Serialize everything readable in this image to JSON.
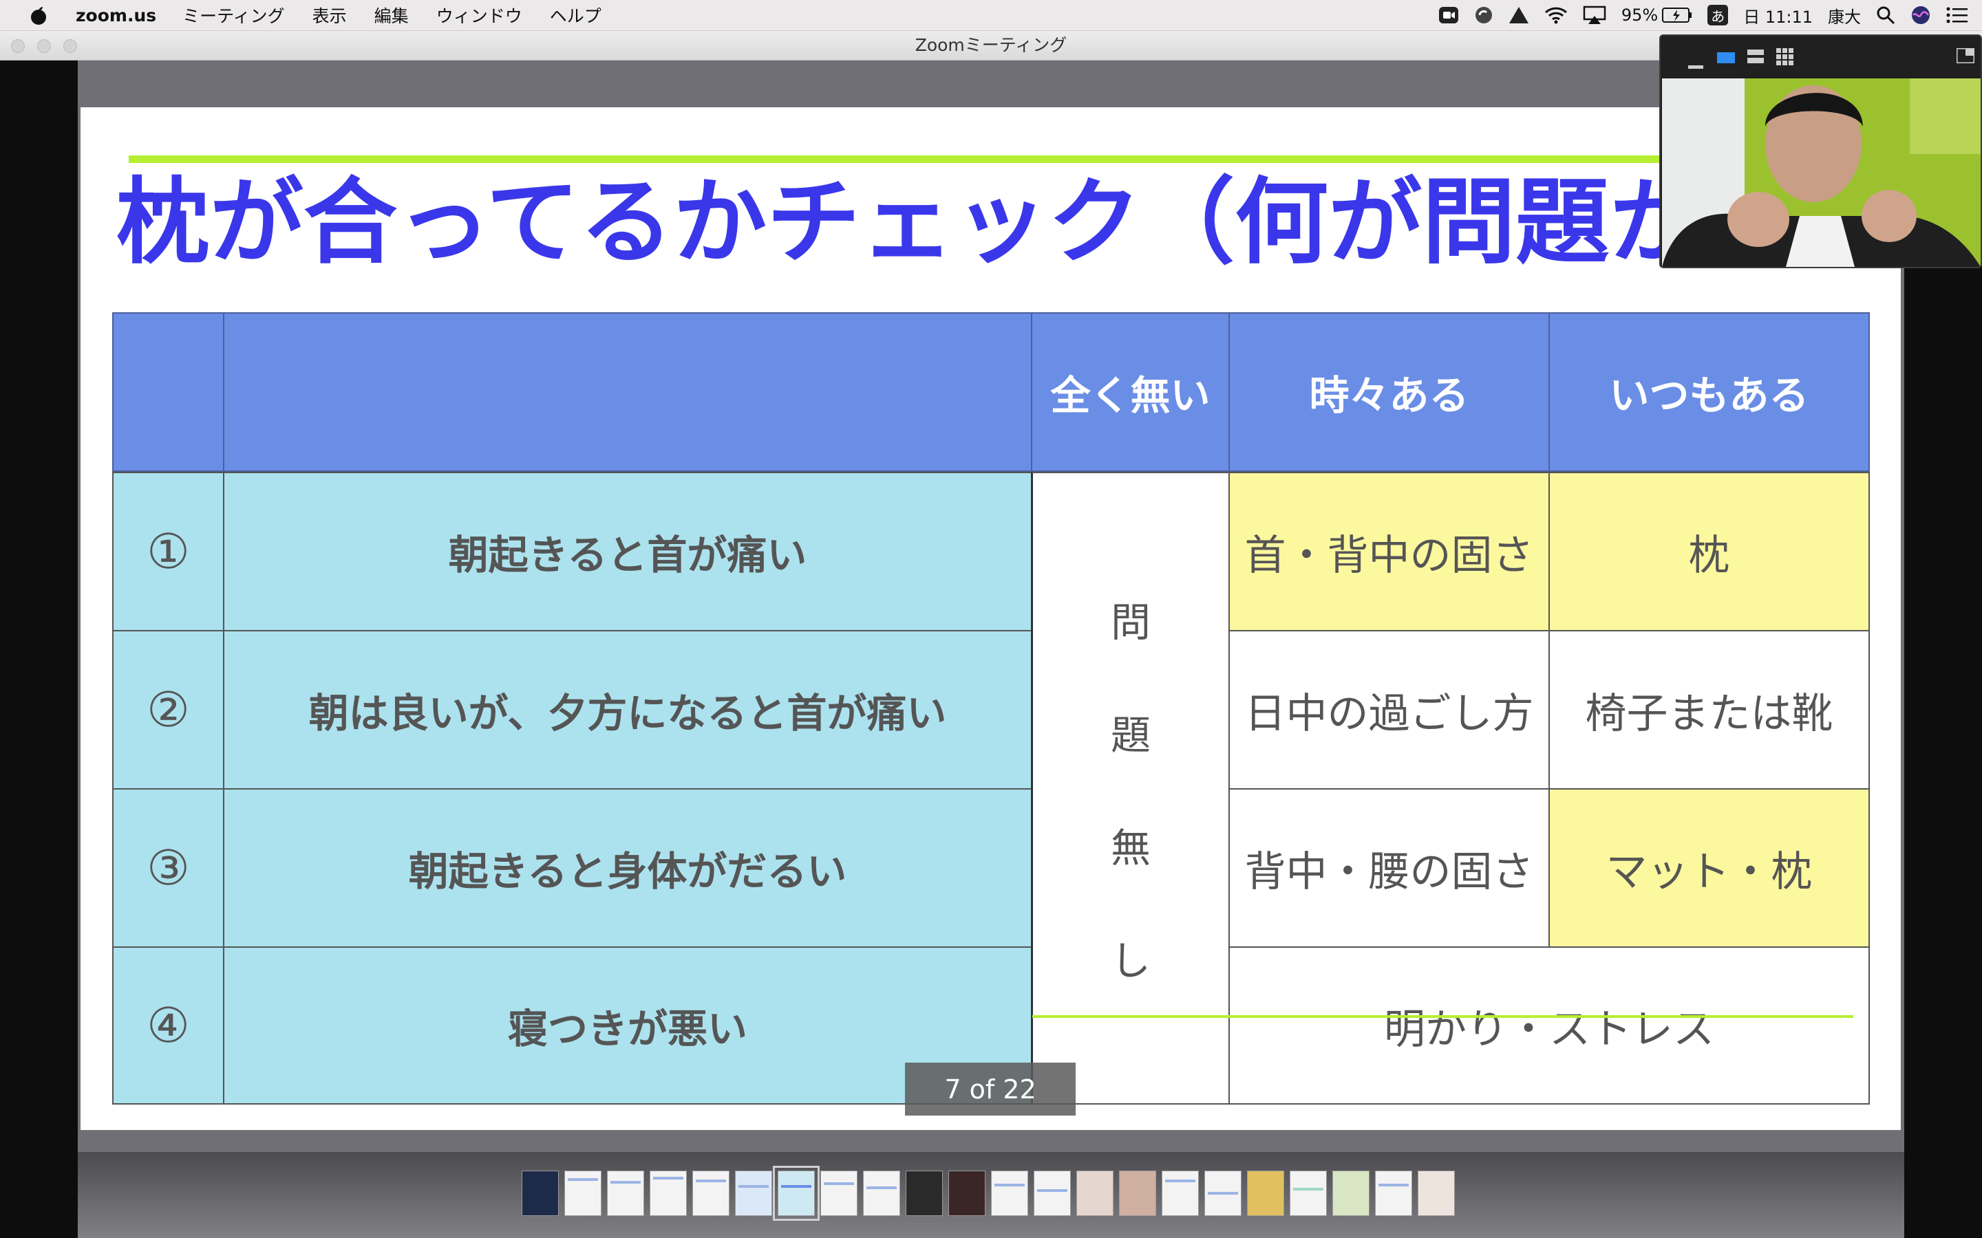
{
  "menubar": {
    "app": "zoom.us",
    "items": [
      "ミーティング",
      "表示",
      "編集",
      "ウィンドウ",
      "ヘルプ"
    ],
    "battery": "95%",
    "ime": "あ",
    "clock": "日 11:11",
    "user": "康大"
  },
  "window": {
    "title": "Zoomミーティング"
  },
  "slide": {
    "title": "枕が合ってるかチェック（何が問題か）",
    "headers": [
      "",
      "",
      "全く無い",
      "時々ある",
      "いつもある"
    ],
    "rows": [
      {
        "num": "①",
        "symptom": "朝起きると首が痛い",
        "sometimes": "首・背中の固さ",
        "always": "枕"
      },
      {
        "num": "②",
        "symptom": "朝は良いが、夕方になると首が痛い",
        "sometimes": "日中の過ごし方",
        "always": "椅子または靴"
      },
      {
        "num": "③",
        "symptom": "朝起きると身体がだるい",
        "sometimes": "背中・腰の固さ",
        "always": "マット・枕"
      },
      {
        "num": "④",
        "symptom": "寝つきが悪い",
        "merged": "明かり・ストレス"
      }
    ],
    "no_problem_chars": [
      "問",
      "題",
      "無",
      "し"
    ]
  },
  "page_indicator": "7 of 22",
  "colors": {
    "title": "#3a37ea",
    "header_bg": "#6a8ee6",
    "row_bg": "#ace2ee",
    "highlight": "#fbf89e",
    "accent_line": "#b6ef31"
  }
}
